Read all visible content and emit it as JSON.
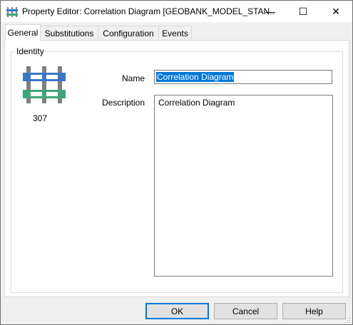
{
  "window": {
    "title": "Property Editor: Correlation Diagram [GEOBANK_MODEL_STAN..",
    "min_glyph": "—",
    "max_glyph": "☐",
    "close_glyph": "✕"
  },
  "tabs": [
    {
      "label": "General",
      "active": true
    },
    {
      "label": "Substitutions",
      "active": false
    },
    {
      "label": "Configuration",
      "active": false
    },
    {
      "label": "Events",
      "active": false
    }
  ],
  "identity": {
    "group_label": "Identity",
    "icon": "correlation-diagram-icon",
    "id_number": "307",
    "name_label": "Name",
    "name_value": "Correlation Diagram",
    "description_label": "Description",
    "description_value": "Correlation Diagram"
  },
  "buttons": {
    "ok": "OK",
    "cancel": "Cancel",
    "help": "Help"
  },
  "colors": {
    "accent": "#0078d7",
    "icon_blue": "#3a77c6",
    "icon_green": "#3fa57a",
    "icon_gray": "#808080"
  }
}
